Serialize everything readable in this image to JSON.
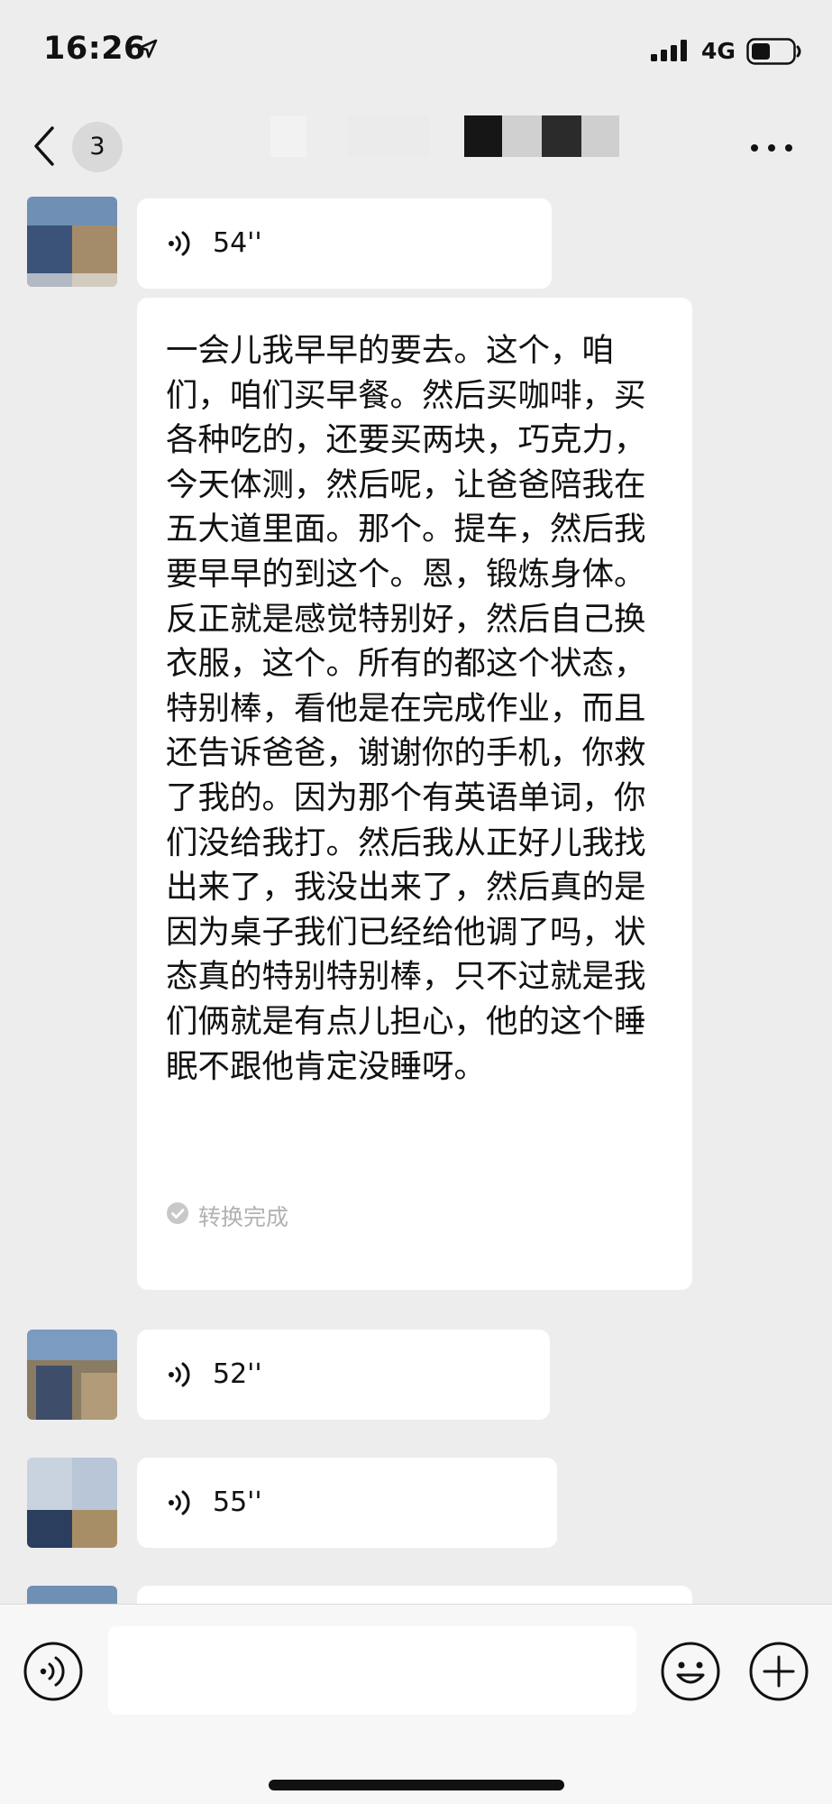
{
  "status_bar": {
    "time": "16:26",
    "network": "4G"
  },
  "nav": {
    "unread_count": "3"
  },
  "messages": [
    {
      "type": "voice",
      "duration": "54''"
    },
    {
      "type": "transcript",
      "text": "一会儿我早早的要去。这个，咱们，咱们买早餐。然后买咖啡，买各种吃的，还要买两块，巧克力，今天体测，然后呢，让爸爸陪我在五大道里面。那个。提车，然后我要早早的到这个。恩，锻炼身体。反正就是感觉特别好，然后自己换衣服，这个。所有的都这个状态，特别棒，看他是在完成作业，而且还告诉爸爸，谢谢你的手机，你救了我的。因为那个有英语单词，你们没给我打。然后我从正好儿我找出来了，我没出来了，然后真的是因为桌子我们已经给他调了吗，状态真的特别特别棒，只不过就是我们俩就是有点儿担心，他的这个睡眠不跟他肯定没睡呀。",
      "status": "转换完成"
    },
    {
      "type": "voice",
      "duration": "52''"
    },
    {
      "type": "voice",
      "duration": "55''"
    }
  ],
  "input": {
    "placeholder": ""
  },
  "colors": {
    "background": "#ededed",
    "bubble": "#ffffff",
    "input_bar": "#f7f7f7",
    "status_grey": "#b2b2b2"
  },
  "icons": {
    "location": "location-arrow-icon",
    "signal": "signal-bars-icon",
    "battery": "battery-icon",
    "back": "chevron-left-icon",
    "more": "more-dots-icon",
    "voice": "voice-wave-icon",
    "check": "check-circle-icon",
    "emoji": "emoji-smile-icon",
    "plus": "plus-circle-icon"
  }
}
